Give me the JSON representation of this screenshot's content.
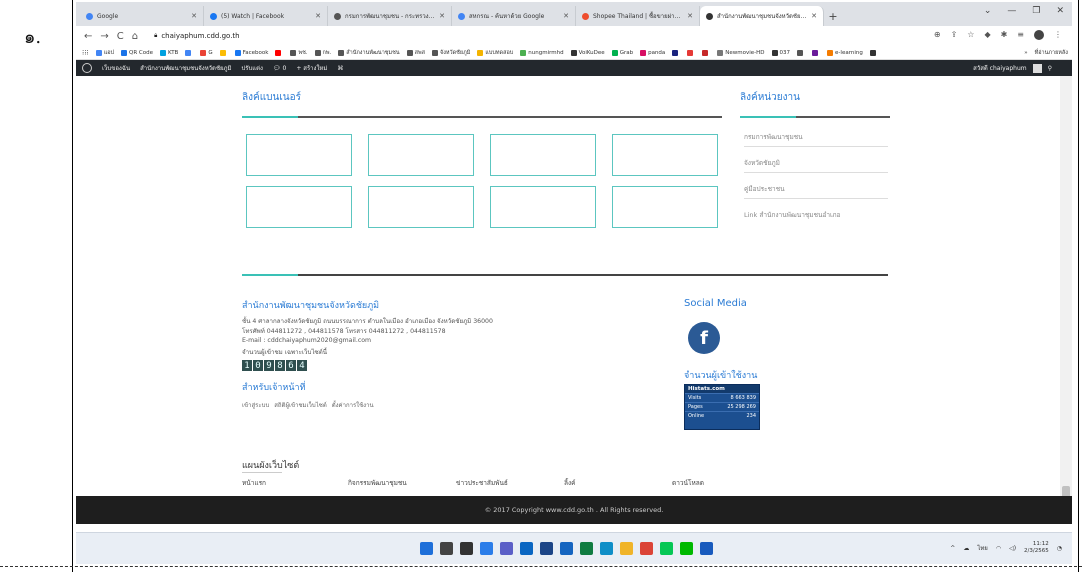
{
  "doc": {
    "list_number": "๑."
  },
  "browser": {
    "tabs": [
      {
        "title": "Google",
        "favicon_color": "#4285f4",
        "active": false
      },
      {
        "title": "(5) Watch | Facebook",
        "favicon_color": "#1877f2",
        "active": false
      },
      {
        "title": "กรมการพัฒนาชุมชน - กระทรวงมหาดไทย",
        "favicon_color": "#555555",
        "active": false
      },
      {
        "title": "สหกรณ - ค้นหาด้วย Google",
        "favicon_color": "#4285f4",
        "active": false
      },
      {
        "title": "Shopee Thailand | ซื้อขายผ่านมือถือ",
        "favicon_color": "#ee4d2d",
        "active": false
      },
      {
        "title": "สำนักงานพัฒนาชุมชนจังหวัดชัยภูมิ",
        "favicon_color": "#333333",
        "active": true
      }
    ],
    "new_tab": "+",
    "url": "chaiyaphum.cdd.go.th",
    "bookmarks": [
      {
        "label": "แอป",
        "color": "#4285f4"
      },
      {
        "label": "QR Code",
        "color": "#1a73e8"
      },
      {
        "label": "KTB",
        "color": "#00a1e0"
      },
      {
        "label": "",
        "color": "#4285f4"
      },
      {
        "label": "G",
        "color": "#ea4335"
      },
      {
        "label": "",
        "color": "#fbbc05"
      },
      {
        "label": "Facebook",
        "color": "#1877f2"
      },
      {
        "label": "",
        "color": "#ff0000"
      },
      {
        "label": "พช.",
        "color": "#555555"
      },
      {
        "label": "กพ.",
        "color": "#555555"
      },
      {
        "label": "สำนักงานพัฒนาชุมชน",
        "color": "#555555"
      },
      {
        "label": "สพส",
        "color": "#555555"
      },
      {
        "label": "จังหวัดชัยภูมิ",
        "color": "#555555"
      },
      {
        "label": "แบบทดสอบ",
        "color": "#f4b400"
      },
      {
        "label": "nungmirmhd",
        "color": "#4caf50"
      },
      {
        "label": "VoiKuDee",
        "color": "#333333"
      },
      {
        "label": "Grab",
        "color": "#00b14f"
      },
      {
        "label": "panda",
        "color": "#d70f64"
      },
      {
        "label": "",
        "color": "#1a237e"
      },
      {
        "label": "",
        "color": "#e53935"
      },
      {
        "label": "",
        "color": "#c62828"
      },
      {
        "label": "Newmovie-HD",
        "color": "#777777"
      },
      {
        "label": "037",
        "color": "#333333"
      },
      {
        "label": "",
        "color": "#555555"
      },
      {
        "label": "",
        "color": "#6a1b9a"
      },
      {
        "label": "e-learning",
        "color": "#f57c00"
      },
      {
        "label": "",
        "color": "#333333"
      }
    ],
    "bookmarks_more": "»",
    "reading_list": "ที่อ่านภายหลัง"
  },
  "wpbar": {
    "items": [
      "เว็บของฉัน",
      "สำนักงานพัฒนาชุมชนจังหวัดชัยภูมิ",
      "ปรับแต่ง",
      "0",
      "+ สร้างใหม่"
    ],
    "greeting": "สวัสดี chaiyaphum"
  },
  "page": {
    "banner_links_title": "ลิงค์แบนเนอร์",
    "agency_links_title": "ลิงค์หน่วยงาน",
    "agency_links": [
      "กรมการพัฒนาชุมชน",
      "จังหวัดชัยภูมิ",
      "คู่มือประชาชน",
      "Link สำนักงานพัฒนาชุมชนอำเภอ"
    ],
    "office_name": "สำนักงานพัฒนาชุมชนจังหวัดชัยภูมิ",
    "address_lines": [
      "ชั้น 4 ศาลากลางจังหวัดชัยภูมิ ถนนบรรณาการ ตำบลในเมือง อำเภอเมือง จังหวัดชัยภูมิ 36000",
      "โทรศัพท์ 044811272 , 044811578 โทรสาร 044811272 , 044811578",
      "E-mail : cddchaiyaphum2020@gmail.com",
      "จำนวนผู้เข้าชม เฉพาะเว็บไซต์นี้"
    ],
    "counter_digits": [
      "1",
      "0",
      "9",
      "8",
      "6",
      "4"
    ],
    "staff_title": "สำหรับเจ้าหน้าที่",
    "staff_links": [
      "เข้าสู่ระบบ",
      "สถิติผู้เข้าชมเว็บไซต์",
      "ตั้งค่าการใช้งาน"
    ],
    "social_title": "Social Media",
    "social_icon": "f",
    "visitors_title": "จำนวนผู้เข้าใช้งาน",
    "histats": {
      "brand": "Histats.com",
      "rows": [
        {
          "label": "Visits",
          "value": "8 663 839"
        },
        {
          "label": "Pages",
          "value": "25 298 269"
        },
        {
          "label": "Online",
          "value": "234"
        }
      ]
    },
    "sitemap_title": "แผนผังเว็บไซต์",
    "sitemap_items": [
      "หน้าแรก",
      "กิจกรรมพัฒนาชุมชน",
      "ข่าวประชาสัมพันธ์",
      "ลิ้งค์",
      "ดาวน์โหลด"
    ],
    "footer": "© 2017 Copyright www.cdd.go.th . All Rights reserved."
  },
  "taskbar": {
    "icons": [
      {
        "name": "windows-start-icon",
        "color": "#1e6fd9"
      },
      {
        "name": "search-icon",
        "color": "#444444"
      },
      {
        "name": "task-view-icon",
        "color": "#333333"
      },
      {
        "name": "widgets-icon",
        "color": "#2b7de9"
      },
      {
        "name": "chat-icon",
        "color": "#5b5fc7"
      },
      {
        "name": "file-explorer-icon",
        "color": "#0a66c2"
      },
      {
        "name": "store-icon",
        "color": "#1c4587"
      },
      {
        "name": "app-icon",
        "color": "#1565c0"
      },
      {
        "name": "excel-icon",
        "color": "#107c41"
      },
      {
        "name": "edge-icon",
        "color": "#0f8ec7"
      },
      {
        "name": "folder-icon",
        "color": "#f0b429"
      },
      {
        "name": "chrome-icon",
        "color": "#db4437"
      },
      {
        "name": "line-icon",
        "color": "#06c755"
      },
      {
        "name": "line-alt-icon",
        "color": "#00b900"
      },
      {
        "name": "word-icon",
        "color": "#185abd"
      }
    ],
    "language": "ไทย",
    "time": "11:12",
    "date": "2/3/2565"
  }
}
